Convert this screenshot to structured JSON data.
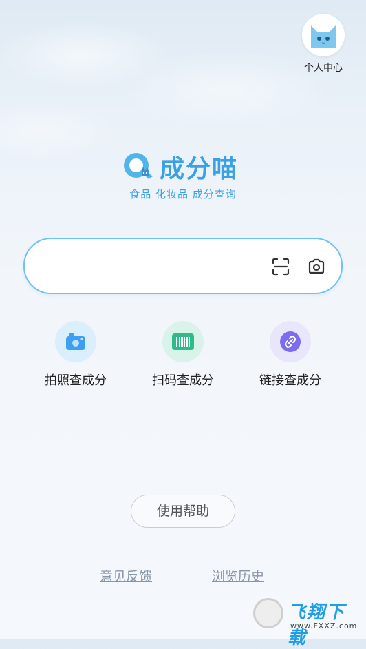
{
  "profile": {
    "label": "个人中心",
    "icon": "cat-avatar-icon"
  },
  "brand": {
    "name": "成分喵",
    "tagline": "食品 化妆品 成分查询",
    "color": "#3aa2e4"
  },
  "search": {
    "value": "",
    "placeholder": "",
    "scan_icon": "scan-icon",
    "camera_icon": "camera-icon",
    "border_color": "#6cc3ee"
  },
  "actions": [
    {
      "label": "拍照查成分",
      "icon": "photo-camera-icon"
    },
    {
      "label": "扫码查成分",
      "icon": "barcode-icon"
    },
    {
      "label": "链接查成分",
      "icon": "link-icon"
    }
  ],
  "help": {
    "label": "使用帮助"
  },
  "footer": {
    "feedback": "意见反馈",
    "history": "浏览历史"
  },
  "watermark": {
    "text": "飞翔下载",
    "url": "www.FXXZ.com"
  }
}
